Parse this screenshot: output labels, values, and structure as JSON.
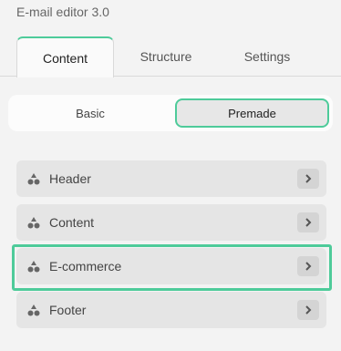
{
  "app": {
    "title": "E-mail editor 3.0"
  },
  "tabs": [
    {
      "label": "Content",
      "active": true
    },
    {
      "label": "Structure",
      "active": false
    },
    {
      "label": "Settings",
      "active": false
    }
  ],
  "segmented": [
    {
      "label": "Basic",
      "active": false
    },
    {
      "label": "Premade",
      "active": true
    }
  ],
  "blocks": [
    {
      "label": "Header",
      "icon": "blocks-icon"
    },
    {
      "label": "Content",
      "icon": "blocks-icon"
    },
    {
      "label": "E-commerce",
      "icon": "blocks-icon",
      "highlighted": true
    },
    {
      "label": "Footer",
      "icon": "blocks-icon"
    }
  ],
  "colors": {
    "accent": "#4ecb9a",
    "background": "#f3f3f3",
    "item_bg": "#e5e5e5"
  }
}
